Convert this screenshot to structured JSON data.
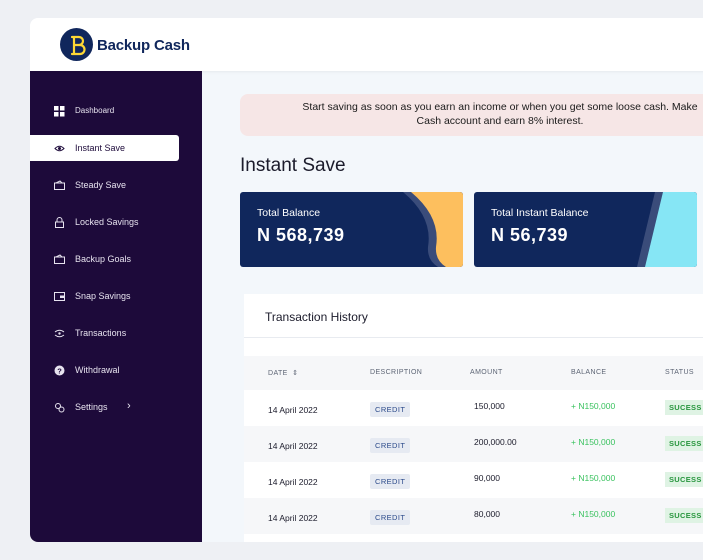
{
  "app": {
    "name": "Backup Cash"
  },
  "colors": {
    "navy": "#10275c",
    "sidebar": "#1d0a3a",
    "orange": "#fdbf5e",
    "cyan": "#86e6f5",
    "green": "#3ac25f"
  },
  "sidebar": {
    "items": [
      {
        "label": "Dashboard",
        "icon": "dashboard-grid-icon",
        "active": false
      },
      {
        "label": "Instant Save",
        "icon": "eye-icon",
        "active": true
      },
      {
        "label": "Steady Save",
        "icon": "wallet-icon",
        "active": false
      },
      {
        "label": "Locked Savings",
        "icon": "lock-icon",
        "active": false
      },
      {
        "label": "Backup Goals",
        "icon": "goals-icon",
        "active": false
      },
      {
        "label": "Snap Savings",
        "icon": "snap-wallet-icon",
        "active": false
      },
      {
        "label": "Transactions",
        "icon": "transactions-icon",
        "active": false
      },
      {
        "label": "Withdrawal",
        "icon": "withdrawal-icon",
        "active": false
      },
      {
        "label": "Settings",
        "icon": "settings-icon",
        "active": false,
        "chevron": "›"
      }
    ]
  },
  "banner": {
    "line1": "Start saving as soon as you earn an income or when you get some loose cash. Make",
    "line2": "Cash account and earn 8% interest."
  },
  "page": {
    "title": "Instant Save"
  },
  "cards": [
    {
      "label": "Total Balance",
      "value": "N 568,739"
    },
    {
      "label": "Total Instant Balance",
      "value": "N 56,739"
    }
  ],
  "transactions": {
    "title": "Transaction History",
    "columns": {
      "date": "DATE",
      "sort_icon": "⇕",
      "description": "DESCRIPTION",
      "amount": "AMOUNT",
      "balance": "BALANCE",
      "status": "STATUS"
    },
    "rows": [
      {
        "date": "14 April 2022",
        "description": "CREDIT",
        "amount": "150,000",
        "balance": "+ N150,000",
        "status": "SUCESS"
      },
      {
        "date": "14 April 2022",
        "description": "CREDIT",
        "amount": "200,000.00",
        "balance": "+ N150,000",
        "status": "SUCESS"
      },
      {
        "date": "14 April 2022",
        "description": "CREDIT",
        "amount": "90,000",
        "balance": "+ N150,000",
        "status": "SUCESS"
      },
      {
        "date": "14 April 2022",
        "description": "CREDIT",
        "amount": "80,000",
        "balance": "+ N150,000",
        "status": "SUCESS"
      }
    ]
  }
}
